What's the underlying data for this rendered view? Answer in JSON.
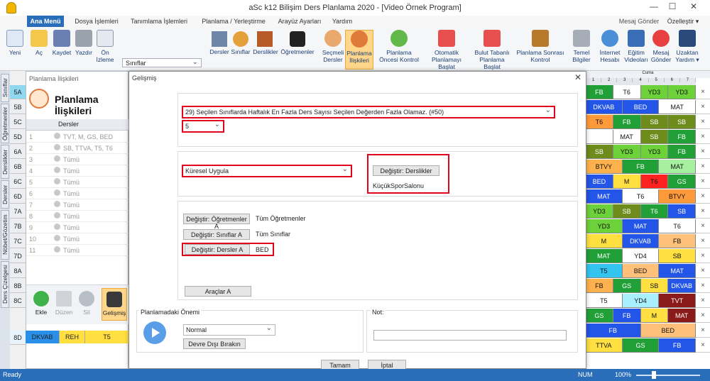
{
  "window": {
    "title": "aSc k12 Bilişim Ders Planlama 2020 - [Video Örnek Program]",
    "right_link": "Özelleştir ▾",
    "mesaj_gonder": "Mesaj Gönder"
  },
  "menu_tabs": [
    "Ana Menü",
    "Dosya İşlemleri",
    "Tanımlama İşlemleri",
    "Planlama / Yerleştirme",
    "Arayüz Ayarları",
    "Yardım"
  ],
  "ribbon": {
    "yeni": "Yeni",
    "ac": "Aç",
    "kaydet": "Kaydet",
    "yazdir": "Yazdır",
    "on_izleme": "Ön İzleme",
    "sinif_dropdown": "Sınıflar",
    "dersler": "Dersler",
    "siniflar": "Sınıflar",
    "derslikler": "Derslikler",
    "ogretmenler": "Öğretmenler",
    "secmeli_dersler": "Seçmeli Dersler",
    "planlama_iliskileri": "Planlama İlişkileri",
    "planlama_oncesi": "Planlama Öncesi Kontrol",
    "otomatik": "Otomatik Planlamayı Başlat",
    "bulut": "Bulut Tabanlı Planlama Başlat",
    "sonrasi": "Planlama Sonrası Kontrol",
    "temel": "Temel Bilgiler",
    "internet": "İnternet Hesabı",
    "egitim": "Eğitim Videoları",
    "mesaj": "Mesaj Gönder",
    "uzaktan": "Uzaktan Yardım ▾"
  },
  "side_tabs": [
    "Sınıflar",
    "Öğretmenler",
    "Derslikler",
    "Dersler",
    "Nöbet/Gözetim",
    "Ders Çizelgesi"
  ],
  "classes": [
    "5A",
    "5B",
    "5C",
    "5D",
    "6A",
    "6B",
    "6C",
    "6D",
    "7A",
    "7B",
    "7C",
    "7D",
    "8A",
    "8B",
    "8C",
    "8D"
  ],
  "left_panel": {
    "title": "Planlama İlişkileri",
    "heading": "Planlama İlişkileri",
    "col_header": "Dersler",
    "rows": [
      {
        "n": "1",
        "t": "TVT, M, GS, BED"
      },
      {
        "n": "2",
        "t": "SB, TTVA, T5, T6"
      },
      {
        "n": "3",
        "t": "Tümü"
      },
      {
        "n": "4",
        "t": "Tümü"
      },
      {
        "n": "5",
        "t": "Tümü"
      },
      {
        "n": "6",
        "t": "Tümü"
      },
      {
        "n": "7",
        "t": "Tümü"
      },
      {
        "n": "8",
        "t": "Tümü"
      },
      {
        "n": "9",
        "t": "Tümü"
      },
      {
        "n": "10",
        "t": "Tümü"
      },
      {
        "n": "11",
        "t": "Tümü"
      }
    ],
    "ekle": "Ekle",
    "duzen": "Düzen",
    "sil": "Sil",
    "gelismis": "Gelişmiş"
  },
  "row8d": [
    "DKVAB",
    "REH",
    "T5"
  ],
  "dialog": {
    "title": "Gelişmiş",
    "rule": "29) Seçilen Sınıflarda Haftalık En Fazla Ders Sayısı Seçilen Değerden Fazla Olamaz. (#50)",
    "value": "5",
    "apply": "Küresel Uygula",
    "degistir_derslikler": "Değiştir: Derslikler",
    "derslik_value": "KüçükSporSalonu",
    "degistir_ogretmenler": "Değiştir: Öğretmenler A",
    "tum_ogretmenler": "Tüm Öğretmenler",
    "degistir_siniflar": "Değiştir: Sınıflar A",
    "tum_siniflar": "Tüm Sınıflar",
    "degistir_dersler": "Değiştir: Dersler A",
    "dersler_value": "BED",
    "araclar": "Araçlar A",
    "onem_label": "Planlamadaki Önemi",
    "onem_value": "Normal",
    "devre_disi": "Devre Dışı Bırakın",
    "not_label": "Not:",
    "tamam": "Tamam",
    "iptal": "İptal"
  },
  "grid": {
    "header_title": "Cuma",
    "header_nums": [
      "1",
      "2",
      "3",
      "4",
      "5",
      "6",
      "7"
    ],
    "rows": [
      [
        [
          "FB",
          "#21a038"
        ],
        [
          "T6",
          "#ffffff"
        ],
        [
          "YD3",
          "#6dd13a"
        ],
        [
          "YD3",
          "#6dd13a"
        ]
      ],
      [
        [
          "DKVAB",
          "#2255e8"
        ],
        [
          "BED",
          "#2255e8"
        ],
        [
          "MAT",
          "#ffffff"
        ]
      ],
      [
        [
          "T6",
          "#ff9a3a"
        ],
        [
          "FB",
          "#21a038"
        ],
        [
          "SB",
          "#6e8c1c"
        ],
        [
          "SB",
          "#6e8c1c"
        ]
      ],
      [
        [
          "",
          "#ffffff"
        ],
        [
          "MAT",
          "#ffffff"
        ],
        [
          "SB",
          "#6e8c1c"
        ],
        [
          "FB",
          "#21a038"
        ]
      ],
      [
        [
          "SB",
          "#6e8c1c"
        ],
        [
          "YD3",
          "#6dd13a"
        ],
        [
          "YD3",
          "#6dd13a"
        ],
        [
          "FB",
          "#21a038"
        ]
      ],
      [
        [
          "BTVY",
          "#ffb14d"
        ],
        [
          "FB",
          "#21a038"
        ],
        [
          "MAT",
          "#a7f0a0"
        ]
      ],
      [
        [
          "BED",
          "#2255e8"
        ],
        [
          "M",
          "#ffe040"
        ],
        [
          "T6",
          "#ff2020"
        ],
        [
          "GS",
          "#21a038"
        ]
      ],
      [
        [
          "MAT",
          "#2255e8"
        ],
        [
          "T6",
          "#ffffff"
        ],
        [
          "BTVY",
          "#ff9a3a"
        ]
      ],
      [
        [
          "YD3",
          "#6dd13a"
        ],
        [
          "SB",
          "#6e8c1c"
        ],
        [
          "T6",
          "#21a038"
        ],
        [
          "SB",
          "#2255e8"
        ]
      ],
      [
        [
          "YD3",
          "#6dd13a"
        ],
        [
          "MAT",
          "#2255e8"
        ],
        [
          "T6",
          "#ffffff"
        ]
      ],
      [
        [
          "M",
          "#ffe040"
        ],
        [
          "DKVAB",
          "#2255e8"
        ],
        [
          "FB",
          "#ffc07a"
        ]
      ],
      [
        [
          "MAT",
          "#21a038"
        ],
        [
          "YD4",
          "#ffffff"
        ],
        [
          "SB",
          "#ffe040"
        ]
      ],
      [
        [
          "T5",
          "#33c4f0"
        ],
        [
          "BED",
          "#ffc07a"
        ],
        [
          "MAT",
          "#2255e8"
        ]
      ],
      [
        [
          "FB",
          "#ffb14d"
        ],
        [
          "GS",
          "#21a038"
        ],
        [
          "SB",
          "#ffe040"
        ],
        [
          "DKVAB",
          "#2255e8"
        ]
      ],
      [
        [
          "T5",
          "#ffffff"
        ],
        [
          "YD4",
          "#a9f0ff"
        ],
        [
          "TVT",
          "#8b1a1a"
        ]
      ],
      [
        [
          "GS",
          "#21a038"
        ],
        [
          "FB",
          "#2255e8"
        ],
        [
          "M",
          "#ffe040"
        ],
        [
          "MAT",
          "#8b1a1a"
        ]
      ],
      [
        [
          "FB",
          "#2255e8"
        ],
        [
          "BED",
          "#ffc07a"
        ]
      ],
      [
        [
          "TTVA",
          "#ffe040"
        ],
        [
          "GS",
          "#21a038"
        ],
        [
          "FB",
          "#2255e8"
        ]
      ]
    ]
  },
  "status": {
    "left": "Ready",
    "num": "NUM",
    "zoom": "100%"
  }
}
